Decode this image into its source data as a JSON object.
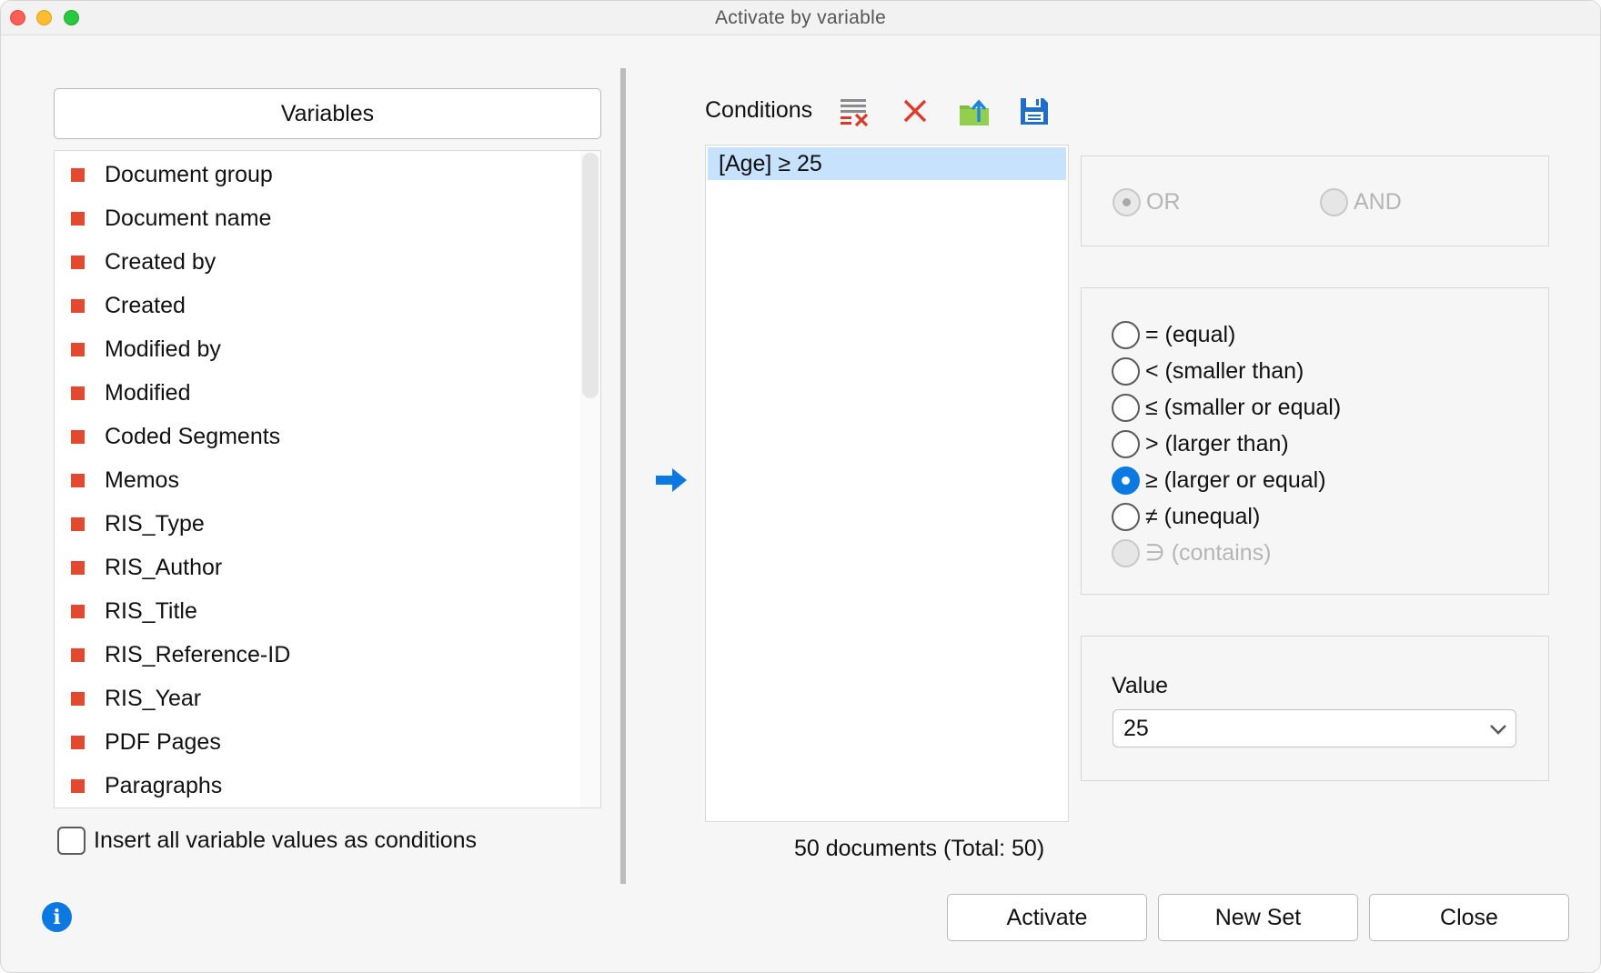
{
  "window": {
    "title": "Activate by variable"
  },
  "variables": {
    "header": "Variables",
    "items": [
      "Document group",
      "Document name",
      "Created by",
      "Created",
      "Modified by",
      "Modified",
      "Coded Segments",
      "Memos",
      "RIS_Type",
      "RIS_Author",
      "RIS_Title",
      "RIS_Reference-ID",
      "RIS_Year",
      "PDF Pages",
      "Paragraphs"
    ],
    "insert_all_label": "Insert all variable values as conditions",
    "insert_all_checked": false
  },
  "conditions": {
    "title": "Conditions",
    "toolbar_icons": [
      "clear-list-icon",
      "delete-icon",
      "export-icon",
      "save-icon"
    ],
    "items": [
      "[Age] ≥ 25"
    ],
    "doc_count": "50 documents (Total: 50)"
  },
  "logic": {
    "or_label": "OR",
    "and_label": "AND",
    "selected": "OR",
    "enabled": false
  },
  "operators": {
    "items": [
      {
        "label": "= (equal)",
        "checked": false,
        "enabled": true
      },
      {
        "label": "< (smaller than)",
        "checked": false,
        "enabled": true
      },
      {
        "label": "≤ (smaller or equal)",
        "checked": false,
        "enabled": true
      },
      {
        "label": "> (larger than)",
        "checked": false,
        "enabled": true
      },
      {
        "label": "≥ (larger or equal)",
        "checked": true,
        "enabled": true
      },
      {
        "label": "≠ (unequal)",
        "checked": false,
        "enabled": true
      },
      {
        "label": "∋ (contains)",
        "checked": false,
        "enabled": false
      }
    ]
  },
  "value": {
    "label": "Value",
    "current": "25"
  },
  "buttons": {
    "activate": "Activate",
    "new_set": "New Set",
    "close": "Close"
  },
  "colors": {
    "accent": "#0c79e3",
    "variable_marker": "#e2492f",
    "selection": "#c6e2fd"
  }
}
